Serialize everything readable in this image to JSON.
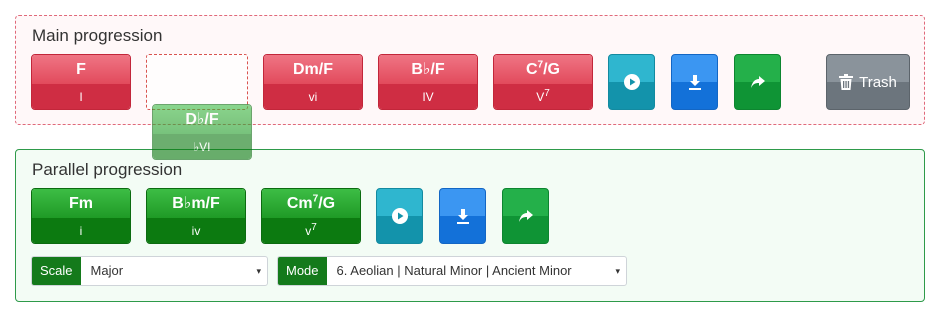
{
  "main": {
    "title": "Main progression",
    "chords": [
      {
        "name": "F",
        "roman": "I"
      },
      {
        "name": "Dm/F",
        "roman": "vi"
      },
      {
        "name": "B♭/F",
        "roman": "IV"
      },
      {
        "name_pre": "C",
        "name_sup": "7",
        "name_post": "/G",
        "roman_pre": "V",
        "roman_sup": "7"
      }
    ],
    "dragging_chord": {
      "name": "D♭/F",
      "roman": "♭VI"
    },
    "trash_label": "Trash"
  },
  "parallel": {
    "title": "Parallel progression",
    "chords": [
      {
        "name": "Fm",
        "roman": "i"
      },
      {
        "name": "B♭m/F",
        "roman": "iv"
      },
      {
        "name_pre": "Cm",
        "name_sup": "7",
        "name_post": "/G",
        "roman_pre": "v",
        "roman_sup": "7"
      }
    ],
    "scale": {
      "label": "Scale",
      "value": "Major"
    },
    "mode": {
      "label": "Mode",
      "value": "6. Aeolian | Natural Minor | Ancient Minor"
    }
  },
  "icons": {
    "play": "play-circle-icon",
    "download": "download-icon",
    "share": "share-arrow-icon",
    "trash": "trash-icon",
    "caret": "▾"
  },
  "colors": {
    "main_border": "#e0697a",
    "chord_red": "#cf2d43",
    "chord_green": "#0c7a10",
    "parallel_border": "#2e9a4a"
  }
}
